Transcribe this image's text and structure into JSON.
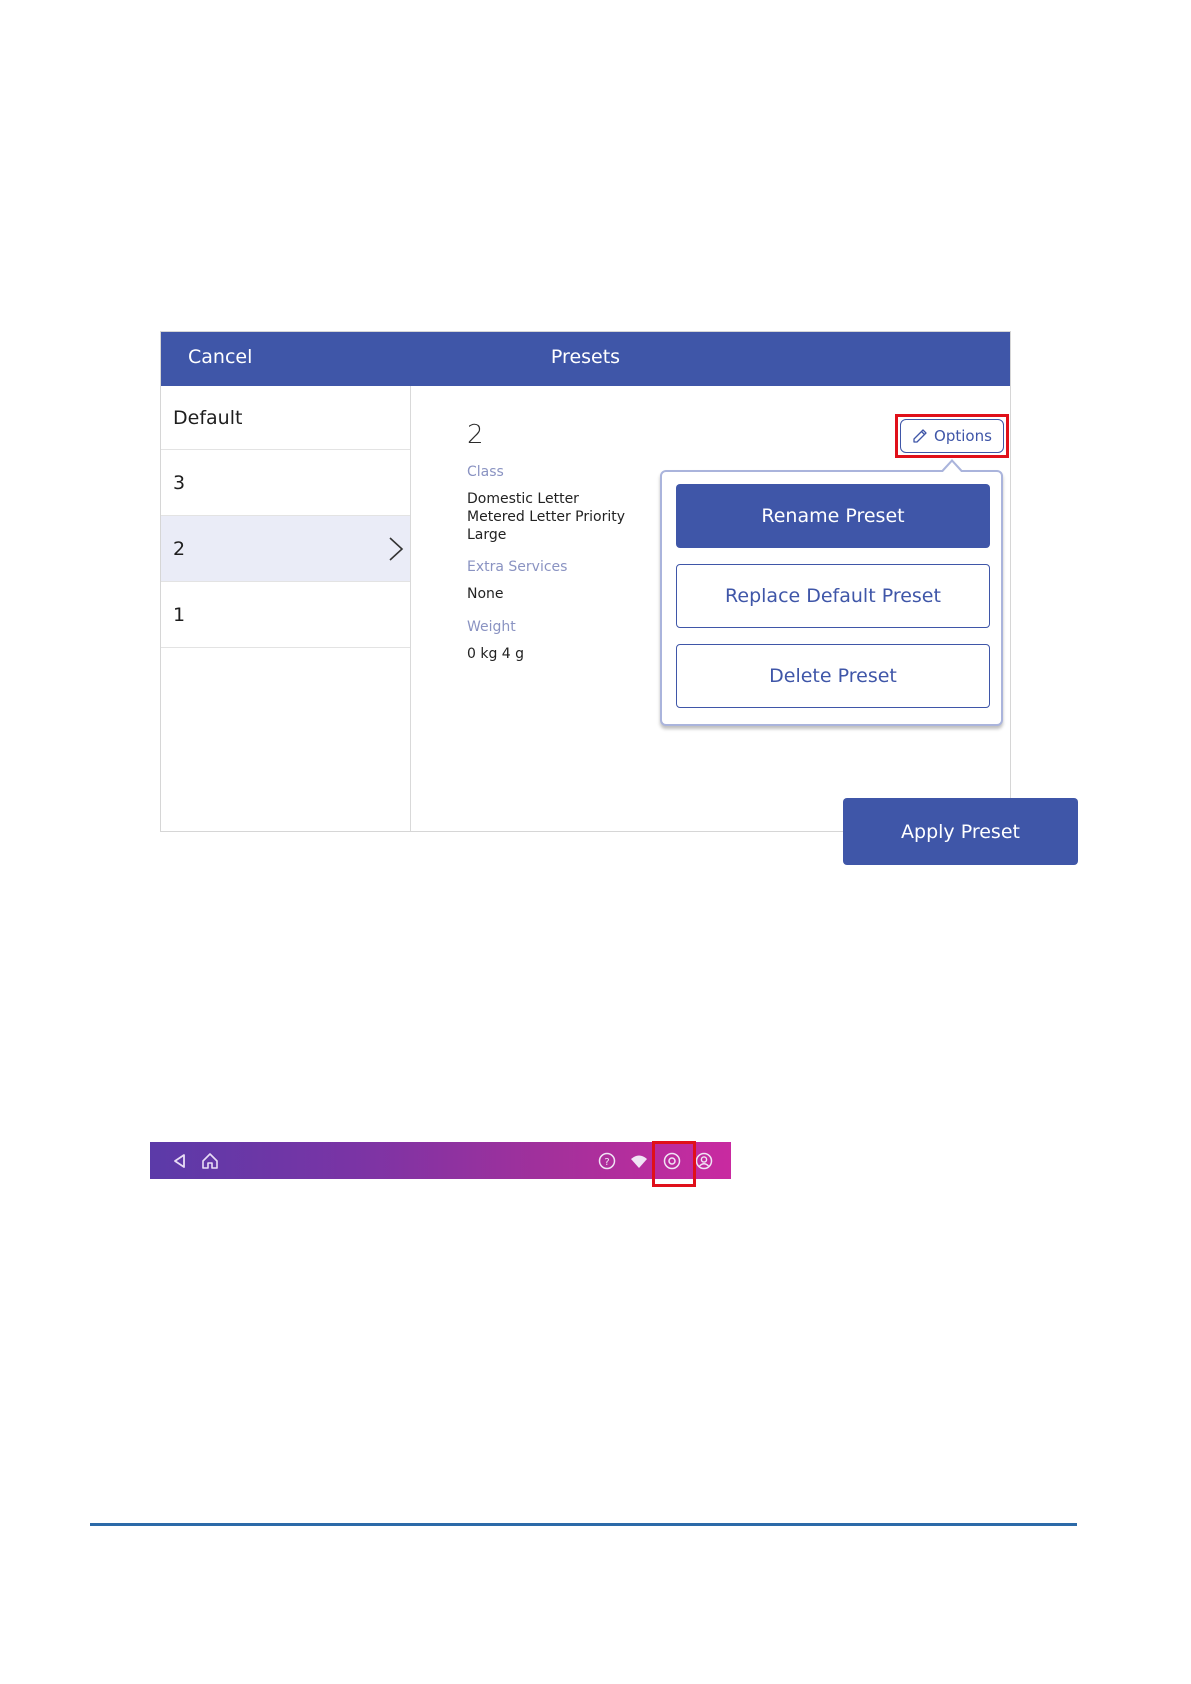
{
  "topbar": {
    "cancel_label": "Cancel",
    "title": "Presets"
  },
  "preset_list": {
    "items": [
      {
        "label": "Default"
      },
      {
        "label": "3"
      },
      {
        "label": "2",
        "selected": true
      },
      {
        "label": "1"
      }
    ]
  },
  "details": {
    "name": "2",
    "options_label": "Options",
    "class_label": "Class",
    "class_value_line1": "Domestic Letter",
    "class_value_line2": "Metered Letter Priority",
    "class_value_line3": "Large",
    "extra_services_label": "Extra Services",
    "extra_services_value": "None",
    "weight_label": "Weight",
    "weight_value": "0 kg 4 g"
  },
  "options_menu": {
    "rename_label": "Rename Preset",
    "replace_default_label": "Replace Default Preset",
    "delete_label": "Delete Preset"
  },
  "apply_label": "Apply Preset",
  "navbar": {
    "icons": [
      "back-icon",
      "home-icon",
      "help-icon",
      "wifi-icon",
      "settings-icon",
      "account-icon"
    ]
  },
  "colors": {
    "primary": "#3f56a8",
    "highlight": "#e0101a",
    "label": "#8a93c2",
    "selected_row": "#eaecf7",
    "rule": "#2c6aa8"
  }
}
